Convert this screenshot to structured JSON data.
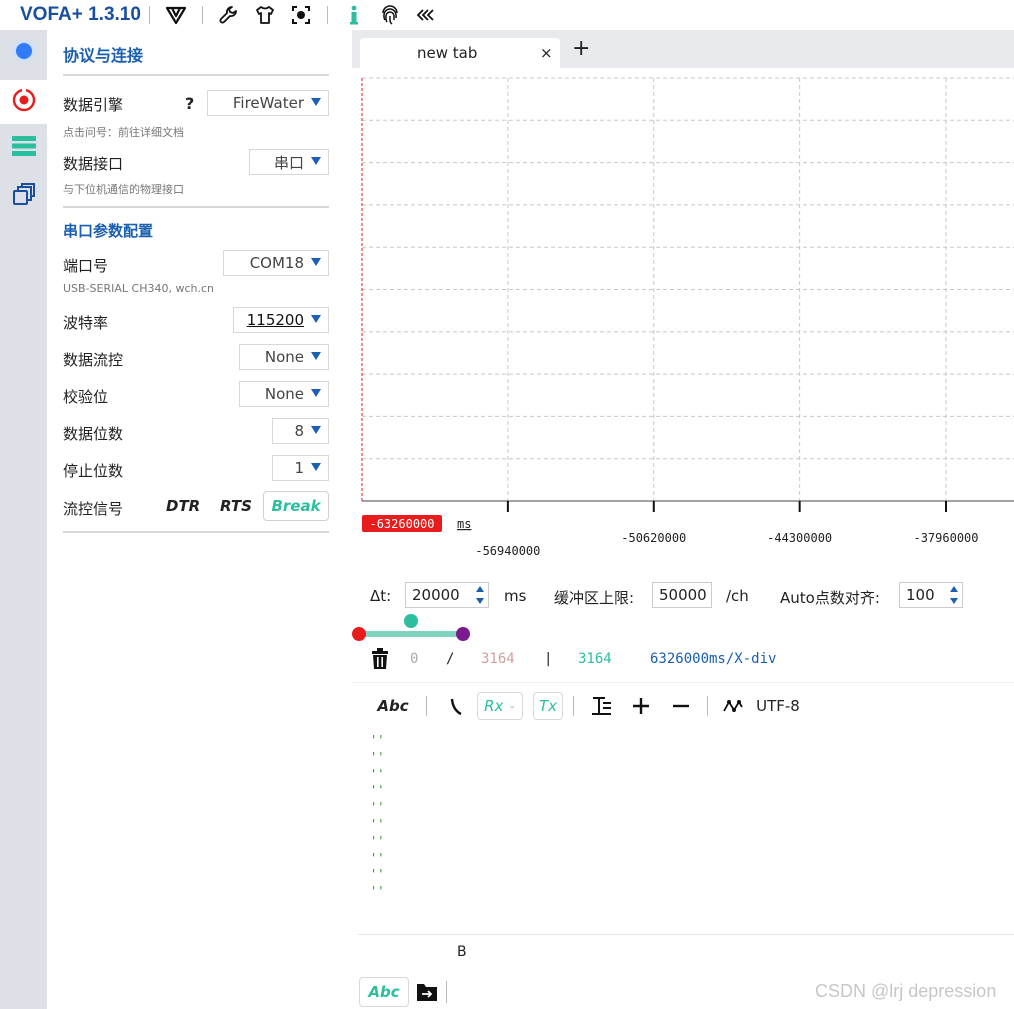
{
  "app": {
    "title": "VOFA+ 1.3.10"
  },
  "sidebar": {
    "items": [
      {
        "icon": "status-dot-icon",
        "active": false
      },
      {
        "icon": "connection-target-icon",
        "active": true
      },
      {
        "icon": "data-list-icon",
        "active": false
      },
      {
        "icon": "windows-copy-icon",
        "active": false
      }
    ]
  },
  "panel": {
    "title": "协议与连接",
    "engine": {
      "label": "数据引擎",
      "help": "?",
      "value": "FireWater",
      "hint": "点击问号：前往详细文档"
    },
    "interface": {
      "label": "数据接口",
      "value": "串口",
      "hint": "与下位机通信的物理接口"
    },
    "serial_section": "串口参数配置",
    "port": {
      "label": "端口号",
      "value": "COM18",
      "hint": "USB-SERIAL CH340, wch.cn"
    },
    "baud": {
      "label": "波特率",
      "value": "115200"
    },
    "flow_control": {
      "label": "数据流控",
      "value": "None"
    },
    "parity": {
      "label": "校验位",
      "value": "None"
    },
    "data_bits": {
      "label": "数据位数",
      "value": "8"
    },
    "stop_bits": {
      "label": "停止位数",
      "value": "1"
    },
    "flow_signal": {
      "label": "流控信号",
      "dtr": "DTR",
      "rts": "RTS",
      "break": "Break"
    }
  },
  "tabs": {
    "label": "new tab",
    "close": "×",
    "add": "+"
  },
  "chart_data": {
    "type": "line",
    "series": [],
    "x_unit": "ms",
    "x_ticks": [
      -63260000,
      -56940000,
      -50620000,
      -44300000,
      -37960000
    ],
    "x_tick_labels": [
      "-63260000",
      "-56940000",
      "-50620000",
      "-44300000",
      "-37960000"
    ],
    "grid": true,
    "highlight_tick": "-63260000"
  },
  "controls": {
    "dt_label": "Δt:",
    "dt_value": "20000",
    "dt_unit": "ms",
    "buffer_label": "缓冲区上限:",
    "buffer_value": "50000",
    "buffer_unit": "/ch",
    "auto_label": "Auto点数对齐:",
    "auto_value": "100"
  },
  "stats": {
    "start": "0",
    "slash": "/",
    "total": "3164",
    "bar": "|",
    "count": "3164",
    "rate": "6326000ms/X-div"
  },
  "rx_toolbar": {
    "abc": "Abc",
    "rx": "Rx",
    "tx": "Tx",
    "encoding": "UTF-8"
  },
  "rx_lines": [
    "''",
    "''",
    "''",
    "''",
    "''",
    "''",
    "''",
    "''",
    "''",
    "''"
  ],
  "tx": {
    "text": "B",
    "abc": "Abc"
  },
  "colors": {
    "accent": "#1a5fb0",
    "teal": "#2bbfa0",
    "red": "#e81c1c",
    "purple": "#7b1a8f"
  },
  "watermark": "CSDN @lrj  depression"
}
